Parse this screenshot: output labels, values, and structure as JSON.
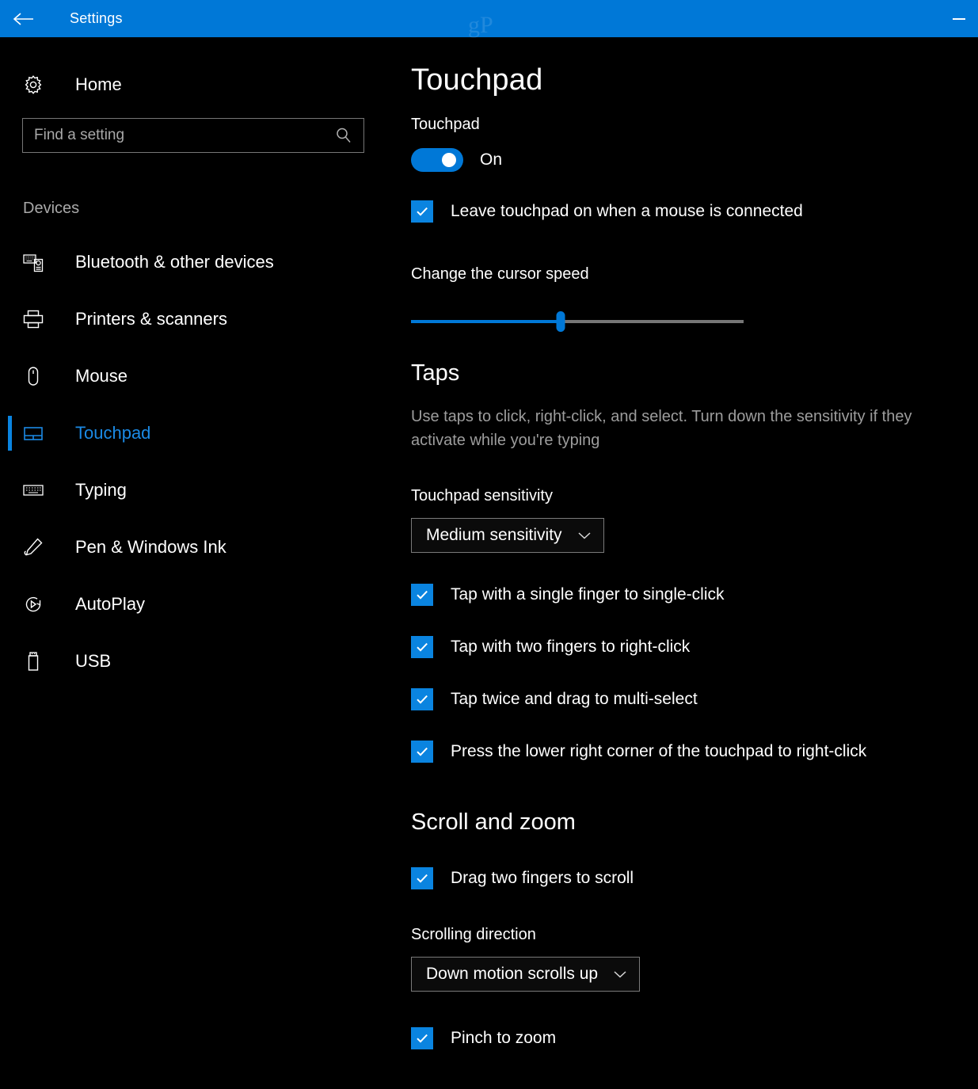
{
  "titlebar": {
    "back_icon": "back-arrow-icon",
    "title": "Settings",
    "watermark": "gP",
    "minimize_label": "–"
  },
  "sidebar": {
    "home": {
      "label": "Home",
      "icon": "gear-icon"
    },
    "search": {
      "placeholder": "Find a setting",
      "value": "",
      "icon": "search-icon"
    },
    "group_title": "Devices",
    "items": [
      {
        "label": "Bluetooth & other devices",
        "icon": "bluetooth-devices-icon",
        "selected": false
      },
      {
        "label": "Printers & scanners",
        "icon": "printer-icon",
        "selected": false
      },
      {
        "label": "Mouse",
        "icon": "mouse-icon",
        "selected": false
      },
      {
        "label": "Touchpad",
        "icon": "touchpad-icon",
        "selected": true
      },
      {
        "label": "Typing",
        "icon": "keyboard-icon",
        "selected": false
      },
      {
        "label": "Pen & Windows Ink",
        "icon": "pen-icon",
        "selected": false
      },
      {
        "label": "AutoPlay",
        "icon": "autoplay-icon",
        "selected": false
      },
      {
        "label": "USB",
        "icon": "usb-drive-icon",
        "selected": false
      }
    ]
  },
  "main": {
    "page_title": "Touchpad",
    "touchpad_label": "Touchpad",
    "touchpad_toggle": {
      "state": "On",
      "checked": true
    },
    "leave_on_checkbox": {
      "label": "Leave touchpad on when a mouse is connected",
      "checked": true
    },
    "cursor_speed": {
      "label": "Change the cursor speed",
      "value_percent": 45,
      "min": 0,
      "max": 100
    },
    "taps": {
      "title": "Taps",
      "description": "Use taps to click, right-click, and select. Turn down the sensitivity if they activate while you're typing",
      "sensitivity_label": "Touchpad sensitivity",
      "sensitivity_value": "Medium sensitivity",
      "options": [
        {
          "label": "Tap with a single finger to single-click",
          "checked": true
        },
        {
          "label": "Tap with two fingers to right-click",
          "checked": true
        },
        {
          "label": "Tap twice and drag to multi-select",
          "checked": true
        },
        {
          "label": "Press the lower right corner of the touchpad to right-click",
          "checked": true
        }
      ]
    },
    "scroll_zoom": {
      "title": "Scroll and zoom",
      "drag_scroll": {
        "label": "Drag two fingers to scroll",
        "checked": true
      },
      "direction_label": "Scrolling direction",
      "direction_value": "Down motion scrolls up",
      "pinch_zoom": {
        "label": "Pinch to zoom",
        "checked": true
      }
    }
  },
  "colors": {
    "accent": "#0078d7",
    "accent_light": "#0a84e0",
    "selected_text": "#1b8ae5",
    "background": "#000000",
    "muted_text": "#9d9d9d"
  }
}
